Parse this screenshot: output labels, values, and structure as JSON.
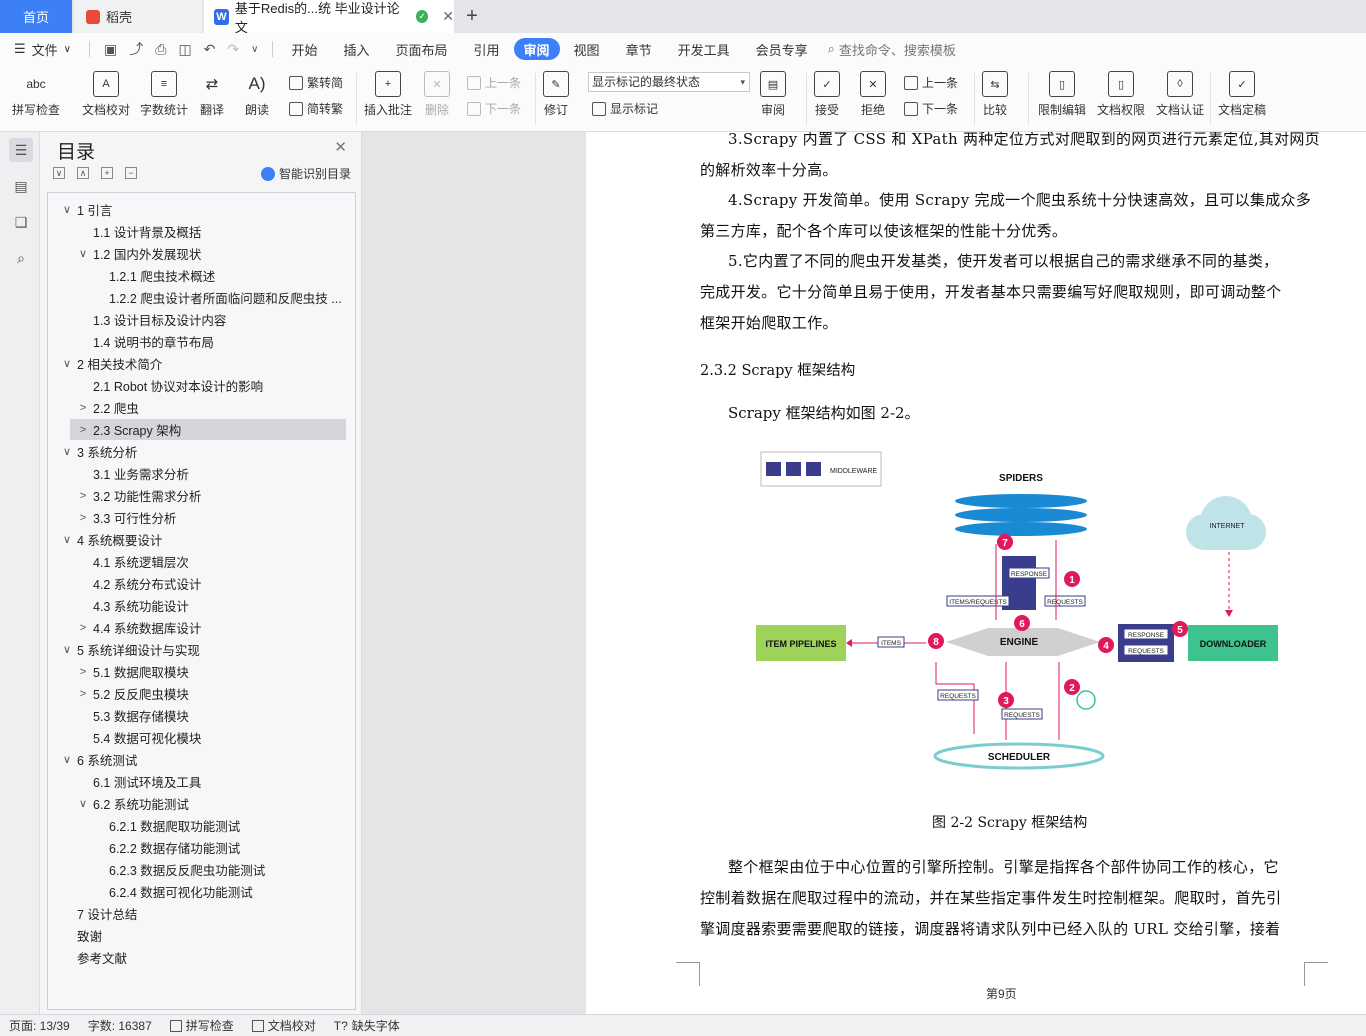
{
  "tabs": {
    "home": "首页",
    "daoke": "稻壳",
    "doc": "基于Redis的...统 毕业设计论文"
  },
  "menu": {
    "file": "文件",
    "items": [
      "开始",
      "插入",
      "页面布局",
      "引用",
      "审阅",
      "视图",
      "章节",
      "开发工具",
      "会员专享"
    ],
    "active": "审阅",
    "search": "查找命令、搜索模板"
  },
  "ribbon": {
    "spellcheck": "拼写检查",
    "doc_proof": "文档校对",
    "word_count": "字数统计",
    "translate": "翻译",
    "read_aloud": "朗读",
    "trad_to_simp": "繁转简",
    "simp_to_trad": "简转繁",
    "insert_comment": "插入批注",
    "delete": "删除",
    "prev_comment": "上一条",
    "next_comment": "下一条",
    "track_changes": "修订",
    "markup_state": "显示标记的最终状态",
    "show_markup": "显示标记",
    "review": "审阅",
    "accept": "接受",
    "reject": "拒绝",
    "prev_change": "上一条",
    "next_change": "下一条",
    "compare": "比较",
    "restrict_edit": "限制编辑",
    "doc_permission": "文档权限",
    "doc_cert": "文档认证",
    "doc_finalize": "文档定稿"
  },
  "toc": {
    "title": "目录",
    "ai_label": "智能识别目录",
    "items": [
      {
        "label": "1  引言",
        "level": 1,
        "arrow": "∨"
      },
      {
        "label": "1.1  设计背景及概括",
        "level": 2,
        "arrow": ""
      },
      {
        "label": "1.2  国内外发展现状",
        "level": 2,
        "arrow": "∨"
      },
      {
        "label": "1.2.1  爬虫技术概述",
        "level": 3,
        "arrow": ""
      },
      {
        "label": "1.2.2  爬虫设计者所面临问题和反爬虫技 ...",
        "level": 3,
        "arrow": ""
      },
      {
        "label": "1.3  设计目标及设计内容",
        "level": 2,
        "arrow": ""
      },
      {
        "label": "1.4  说明书的章节布局",
        "level": 2,
        "arrow": ""
      },
      {
        "label": "2  相关技术简介",
        "level": 1,
        "arrow": "∨"
      },
      {
        "label": "2.1 Robot 协议对本设计的影响",
        "level": 2,
        "arrow": ""
      },
      {
        "label": "2.2  爬虫",
        "level": 2,
        "arrow": ">"
      },
      {
        "label": "2.3 Scrapy 架构",
        "level": 2,
        "arrow": ">"
      },
      {
        "label": "3  系统分析",
        "level": 1,
        "arrow": "∨"
      },
      {
        "label": "3.1  业务需求分析",
        "level": 2,
        "arrow": ""
      },
      {
        "label": "3.2  功能性需求分析",
        "level": 2,
        "arrow": ">"
      },
      {
        "label": "3.3  可行性分析",
        "level": 2,
        "arrow": ">"
      },
      {
        "label": "4  系统概要设计",
        "level": 1,
        "arrow": "∨"
      },
      {
        "label": "4.1  系统逻辑层次",
        "level": 2,
        "arrow": ""
      },
      {
        "label": "4.2  系统分布式设计",
        "level": 2,
        "arrow": ""
      },
      {
        "label": "4.3  系统功能设计",
        "level": 2,
        "arrow": ""
      },
      {
        "label": "4.4  系统数据库设计",
        "level": 2,
        "arrow": ">"
      },
      {
        "label": "5  系统详细设计与实现",
        "level": 1,
        "arrow": "∨"
      },
      {
        "label": "5.1  数据爬取模块",
        "level": 2,
        "arrow": ">"
      },
      {
        "label": "5.2  反反爬虫模块",
        "level": 2,
        "arrow": ">"
      },
      {
        "label": "5.3  数据存储模块",
        "level": 2,
        "arrow": ""
      },
      {
        "label": "5.4  数据可视化模块",
        "level": 2,
        "arrow": ""
      },
      {
        "label": "6  系统测试",
        "level": 1,
        "arrow": "∨"
      },
      {
        "label": "6.1  测试环境及工具",
        "level": 2,
        "arrow": ""
      },
      {
        "label": "6.2  系统功能测试",
        "level": 2,
        "arrow": "∨"
      },
      {
        "label": "6.2.1  数据爬取功能测试",
        "level": 3,
        "arrow": ""
      },
      {
        "label": "6.2.2  数据存储功能测试",
        "level": 3,
        "arrow": ""
      },
      {
        "label": "6.2.3  数据反反爬虫功能测试",
        "level": 3,
        "arrow": ""
      },
      {
        "label": "6.2.4  数据可视化功能测试",
        "level": 3,
        "arrow": ""
      },
      {
        "label": "7  设计总结",
        "level": 1,
        "arrow": ""
      },
      {
        "label": "致谢",
        "level": 1,
        "arrow": ""
      },
      {
        "label": "参考文献",
        "level": 1,
        "arrow": ""
      }
    ]
  },
  "document": {
    "p3_lines": [
      "3.Scrapy 内置了 CSS 和 XPath 两种定位方式对爬取到的网页进行元素定位,其对网页",
      "的解析效率十分高。"
    ],
    "p4_lines": [
      "4.Scrapy 开发简单。使用 Scrapy 完成一个爬虫系统十分快速高效，且可以集成众多",
      "第三方库，配个各个库可以使该框架的性能十分优秀。"
    ],
    "p5_lines": [
      "5.它内置了不同的爬虫开发基类，使开发者可以根据自己的需求继承不同的基类，",
      "完成开发。它十分简单且易于使用，开发者基本只需要编写好爬取规则，即可调动整个",
      "框架开始爬取工作。"
    ],
    "heading": "2.3.2 Scrapy 框架结构",
    "intro": "Scrapy 框架结构如图 2-2。",
    "caption": "图 2-2 Scrapy 框架结构",
    "p6_lines": [
      "整个框架由位于中心位置的引擎所控制。引擎是指挥各个部件协同工作的核心，它",
      "控制着数据在爬取过程中的流动，并在某些指定事件发生时控制框架。爬取时，首先引",
      "擎调度器索要需要爬取的链接，调度器将请求队列中已经入队的 URL 交给引擎，接着"
    ],
    "page_number": "第9页"
  },
  "diagram": {
    "middleware": "MIDDLEWARE",
    "spiders": "SPIDERS",
    "internet": "INTERNET",
    "item_pipelines": "ITEM PIPELINES",
    "engine": "ENGINE",
    "downloader": "DOWNLOADER",
    "scheduler": "SCHEDULER",
    "response": "RESPONSE",
    "requests": "REQUESTS",
    "items_requests": "ITEMS/REQUESTS",
    "items": "ITEMS",
    "steps": [
      "1",
      "2",
      "3",
      "4",
      "5",
      "6",
      "7",
      "8"
    ],
    "colors": {
      "spiders": "#1a8ad4",
      "pipelines": "#9ed35a",
      "downloader": "#3fc38e",
      "step": "#e0195a",
      "middleware": "#3a3c8c",
      "internet": "#bfe4e8",
      "engine": "#cfcfcf",
      "scheduler": "#79cdd0"
    }
  },
  "status": {
    "page": "页面: 13/39",
    "words": "字数: 16387",
    "spell": "拼写检查",
    "proof": "文档校对",
    "missing_font": "缺失字体"
  }
}
